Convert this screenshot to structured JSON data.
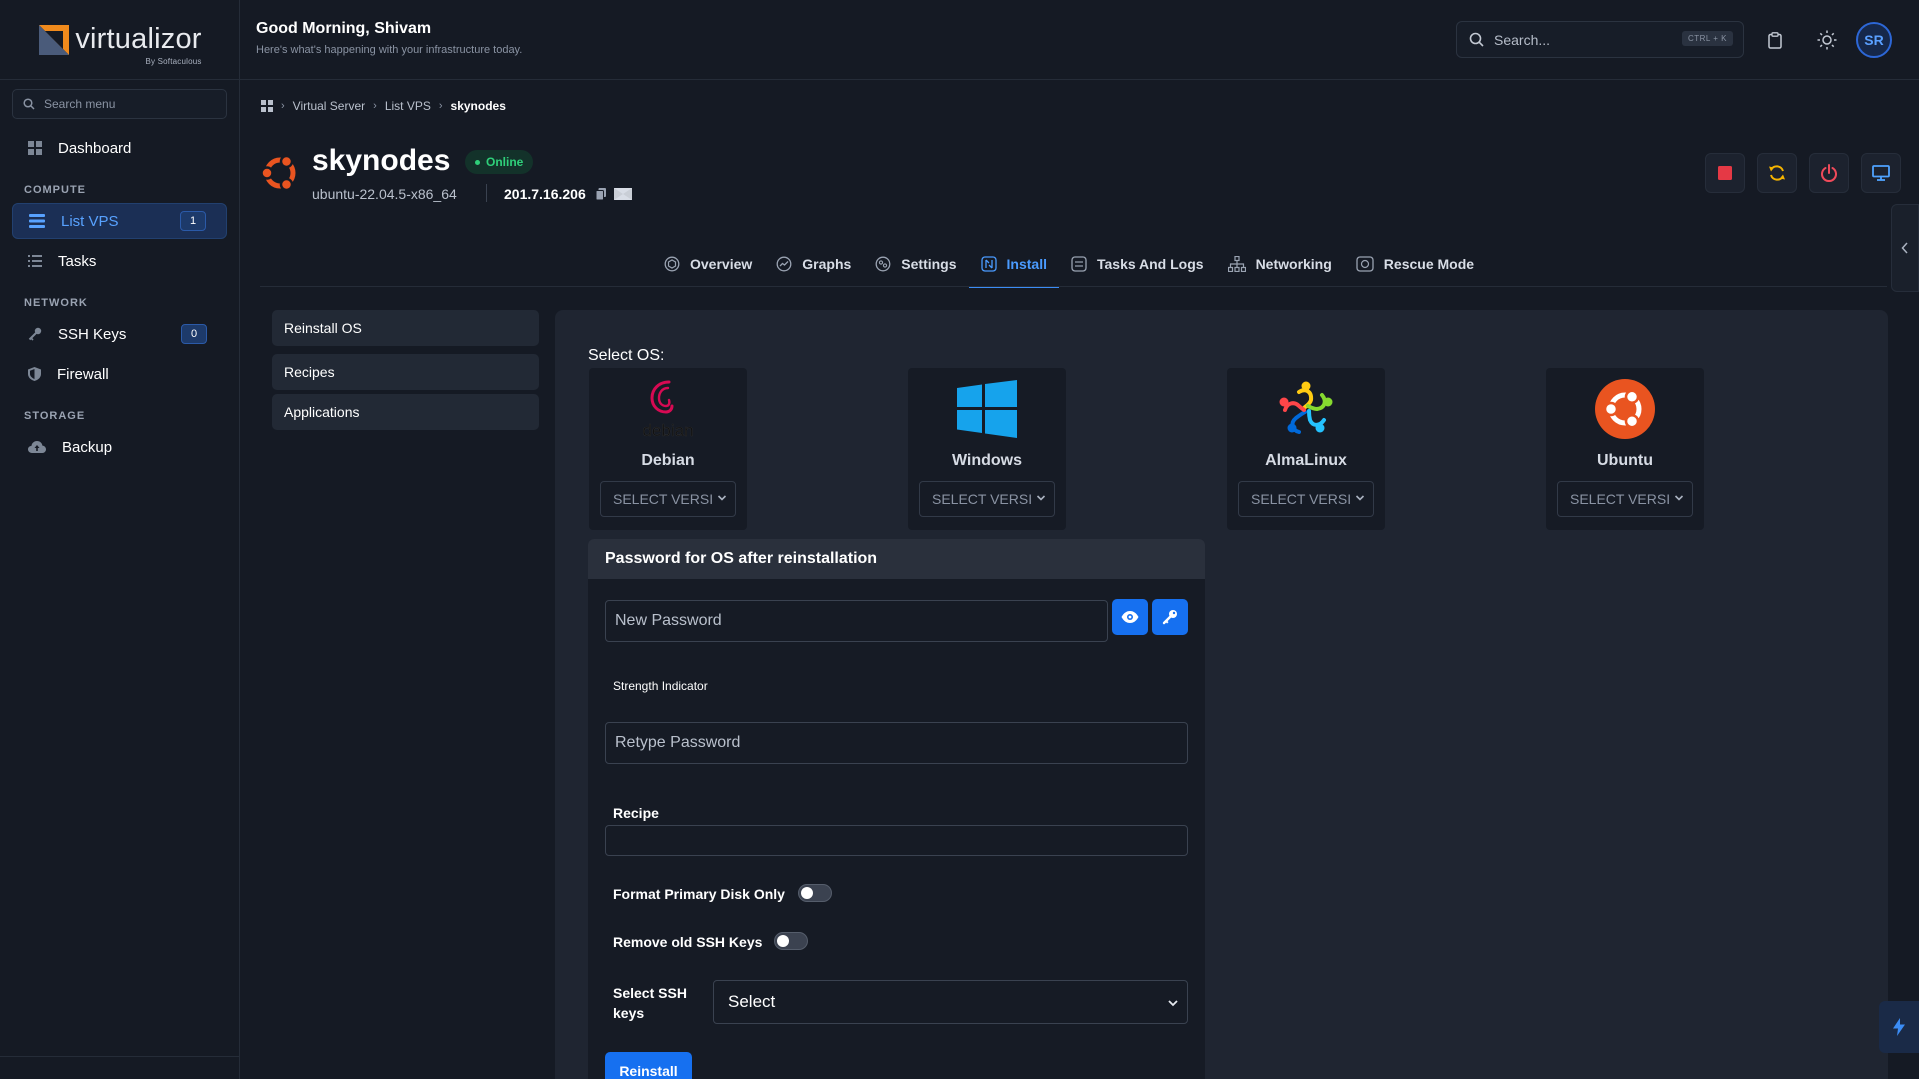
{
  "app": {
    "logo_text": "virtualizor",
    "logo_sub": "By Softaculous"
  },
  "sidebar": {
    "search_placeholder": "Search menu",
    "dashboard": "Dashboard",
    "sections": {
      "compute": "COMPUTE",
      "network": "NETWORK",
      "storage": "STORAGE"
    },
    "items": {
      "list_vps": {
        "label": "List VPS",
        "count": "1"
      },
      "tasks": {
        "label": "Tasks"
      },
      "ssh_keys": {
        "label": "SSH Keys",
        "count": "0"
      },
      "firewall": {
        "label": "Firewall"
      },
      "backup": {
        "label": "Backup"
      }
    }
  },
  "header": {
    "greeting": "Good Morning, Shivam",
    "subtitle": "Here's what's happening with your infrastructure today.",
    "search_placeholder": "Search...",
    "shortcut": "CTRL + K",
    "avatar": "SR"
  },
  "breadcrumb": {
    "items": [
      "Virtual Server",
      "List VPS"
    ],
    "current": "skynodes"
  },
  "vps": {
    "name": "skynodes",
    "status": "Online",
    "os": "ubuntu-22.04.5-x86_64",
    "ip": "201.7.16.206"
  },
  "tabs": [
    "Overview",
    "Graphs",
    "Settings",
    "Install",
    "Tasks And Logs",
    "Networking",
    "Rescue Mode"
  ],
  "submenu": [
    "Reinstall OS",
    "Recipes",
    "Applications"
  ],
  "install": {
    "select_os_label": "Select OS:",
    "os_list": [
      {
        "name": "Debian",
        "select": "SELECT VERSI",
        "icon": "debian-icon",
        "icon_text": "debian"
      },
      {
        "name": "Windows",
        "select": "SELECT VERSI",
        "icon": "windows-icon"
      },
      {
        "name": "AlmaLinux",
        "select": "SELECT VERSI",
        "icon": "almalinux-icon"
      },
      {
        "name": "Ubuntu",
        "select": "SELECT VERSI",
        "icon": "ubuntu-icon"
      }
    ],
    "password_card": {
      "title": "Password for OS after reinstallation",
      "new_password_placeholder": "New Password",
      "strength_label": "Strength Indicator",
      "retype_placeholder": "Retype Password",
      "recipe_label": "Recipe",
      "recipe_value": "",
      "format_label": "Format Primary Disk Only",
      "format_on": false,
      "remove_keys_label": "Remove old SSH Keys",
      "remove_keys_on": false,
      "ssh_keys_label": "Select SSH keys",
      "ssh_keys_value": "Select",
      "submit": "Reinstall"
    }
  },
  "colors": {
    "accent": "#1670f0",
    "online": "#2fd07a",
    "stop": "#e53945",
    "restart": "#f5b400",
    "power": "#ef4a5a",
    "console": "#4fa3ff",
    "ubuntu": "#e95420",
    "windows": "#16a3ec",
    "debian": "#d70a53"
  }
}
